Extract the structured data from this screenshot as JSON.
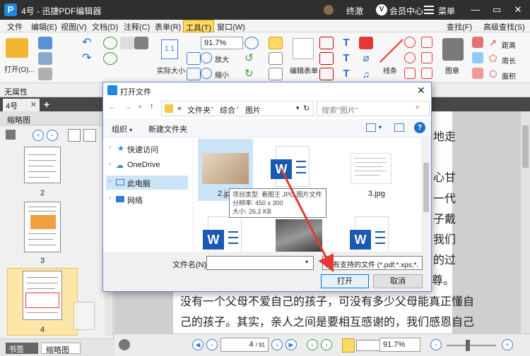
{
  "titlebar": {
    "title": "4号 - 迅捷PDF编辑器",
    "username": "终澈",
    "vip_label": "会员中心",
    "menu_label": "菜单"
  },
  "menubar": {
    "items": [
      "文件",
      "编辑(E)",
      "视图(V)",
      "文档(D)",
      "注释(C)",
      "表单(R)",
      "工具(T)",
      "窗口(W)"
    ],
    "right": [
      "查找(F)",
      "高级查找(S)"
    ]
  },
  "ribbon": {
    "open_label": "打开(O)...",
    "actual_size_label": "实际大小",
    "zoom_value": "91.7%",
    "zoom_in_label": "放大",
    "zoom_out_label": "缩小",
    "edit_form_label": "编辑表单",
    "line_label": "线条",
    "stamp_label": "图章",
    "distance_label": "距离",
    "perimeter_label": "周长",
    "area_label": "面积"
  },
  "attrbar": {
    "label": "无属性"
  },
  "tabbar": {
    "doc_tab": "4号"
  },
  "leftpanel": {
    "title": "缩略图",
    "pages": [
      "2",
      "3",
      "4"
    ],
    "bottom_tabs": [
      "书签",
      "缩略图"
    ]
  },
  "document": {
    "right_snippets": [
      "地走",
      "心甘",
      "一代",
      "子戴",
      "我们",
      "的过",
      "自尊。"
    ],
    "lines": [
      "没有一个父母不爱自己的孩子，可没有多少父母能真正懂自",
      "己的孩子。其实，亲人之间是要相互感谢的，我们感恩自己"
    ]
  },
  "statusbar": {
    "page_value": "4",
    "page_total": "/ 91",
    "zoom_value": "91.7%"
  },
  "dialog": {
    "title": "打开文件",
    "breadcrumb": [
      "«",
      "文件夹",
      "综合",
      "图片"
    ],
    "search_placeholder": "搜索\"图片\"",
    "organize_label": "组织",
    "new_folder_label": "新建文件夹",
    "tree": [
      "快速访问",
      "OneDrive",
      "此电脑",
      "网络"
    ],
    "files": [
      {
        "name": "2.jpg",
        "kind": "photo"
      },
      {
        "name": "",
        "kind": "word"
      },
      {
        "name": "3.jpg",
        "kind": "document-image"
      },
      {
        "name": "",
        "kind": "word"
      },
      {
        "name": "",
        "kind": "photo"
      },
      {
        "name": "",
        "kind": "word"
      }
    ],
    "tooltip": [
      "项目类型: 看图王 JPG 图片文件",
      "分辨率: 450 x 300",
      "大小: 26.2 KB"
    ],
    "filename_label": "文件名(N):",
    "filename_value": "",
    "filetype_value": "所有支持的文件 (*.pdf;*.xps;*.",
    "open_button": "打开",
    "cancel_button": "取消"
  },
  "colors": {
    "titlebar": "#2f2f2f",
    "accent": "#1a5ab0",
    "arrow": "#e53935",
    "active_menu": "#ffd966"
  }
}
